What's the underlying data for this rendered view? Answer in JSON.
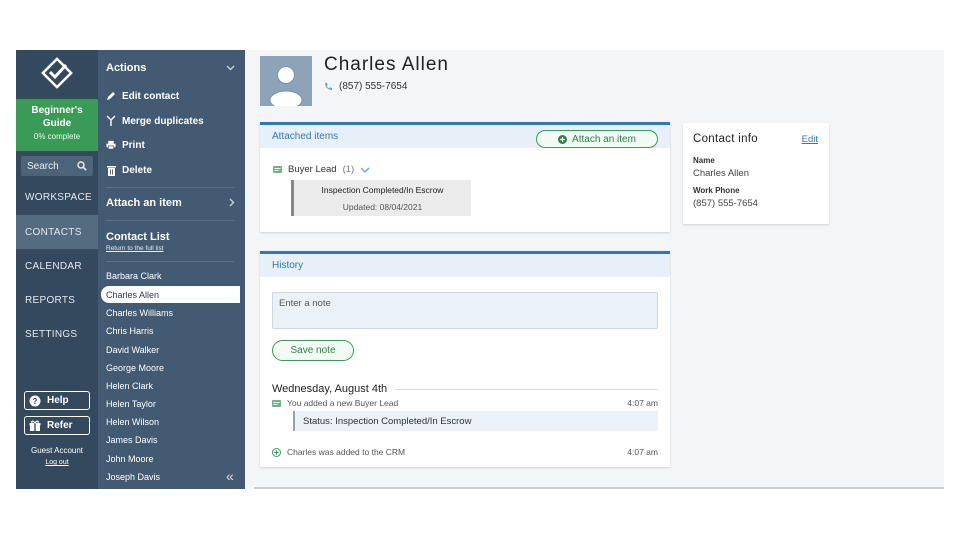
{
  "rail": {
    "guide_title": "Beginner's Guide",
    "guide_progress": "0% complete",
    "search_label": "Search",
    "nav": [
      "WORKSPACE",
      "CONTACTS",
      "CALENDAR",
      "REPORTS",
      "SETTINGS"
    ],
    "active_nav": "CONTACTS",
    "help_label": "Help",
    "refer_label": "Refer",
    "account_label": "Guest Account",
    "logout_label": "Log out"
  },
  "panel": {
    "actions_heading": "Actions",
    "actions": {
      "edit": "Edit contact",
      "merge": "Merge duplicates",
      "print": "Print",
      "delete": "Delete"
    },
    "attach_heading": "Attach an item",
    "list_heading": "Contact List",
    "return_link": "Return to the full list",
    "contacts": [
      "Barbara Clark",
      "Charles Allen",
      "Charles Williams",
      "Chris Harris",
      "David Walker",
      "George Moore",
      "Helen Clark",
      "Helen Taylor",
      "Helen Wilson",
      "James Davis",
      "John Moore",
      "Joseph Davis"
    ],
    "selected_contact": "Charles Allen"
  },
  "contact": {
    "name": "Charles Allen",
    "phone": "(857) 555-7654"
  },
  "attached": {
    "title": "Attached items",
    "attach_button": "Attach an item",
    "lead_label": "Buyer Lead",
    "lead_count": "(1)",
    "lead_status": "Inspection Completed/In Escrow",
    "lead_updated": "Updated: 08/04/2021"
  },
  "history": {
    "title": "History",
    "note_placeholder": "Enter a note",
    "save_button": "Save note",
    "day": "Wednesday, August 4th",
    "entry1_text": "You added a new Buyer Lead",
    "entry1_time": "4:07 am",
    "entry1_status": "Status: Inspection Completed/In Escrow",
    "entry2_text": "Charles was added to the CRM",
    "entry2_time": "4:07 am"
  },
  "contact_info": {
    "title": "Contact info",
    "edit_link": "Edit",
    "name_label": "Name",
    "name_value": "Charles Allen",
    "phone_label": "Work Phone",
    "phone_value": "(857) 555-7654"
  },
  "colors": {
    "rail_bg": "#34495e",
    "panel_bg": "#425a72",
    "accent_blue": "#2d79b8",
    "accent_green": "#3a9b56"
  }
}
